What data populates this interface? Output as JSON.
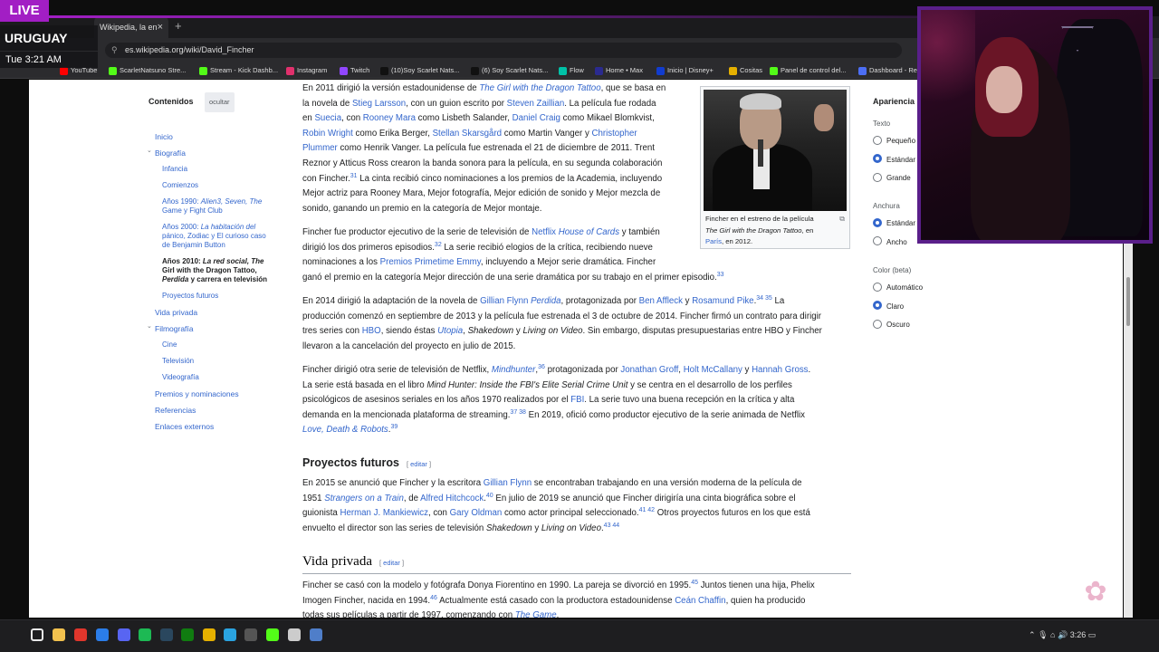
{
  "overlay": {
    "live": "LIVE",
    "country": "URUGUAY",
    "time": "Tue 3:21 AM"
  },
  "browser": {
    "tab_title": "Wikipedia, la en",
    "tab_close": "×",
    "new_tab": "+",
    "url": "es.wikipedia.org/wiki/David_Fincher",
    "bookmarks": [
      {
        "label": "YouTube",
        "color": "#ff0000"
      },
      {
        "label": "ScarletNatsuno Stre...",
        "color": "#53fc18"
      },
      {
        "label": "Stream - Kick Dashb...",
        "color": "#53fc18"
      },
      {
        "label": "Instagram",
        "color": "#e1306c"
      },
      {
        "label": "Twitch",
        "color": "#9146ff"
      },
      {
        "label": "(10)Soy Scarlet Nats...",
        "color": "#111111"
      },
      {
        "label": "(6) Soy Scarlet Nats...",
        "color": "#111111"
      },
      {
        "label": "Flow",
        "color": "#00c2a8"
      },
      {
        "label": "Home • Max",
        "color": "#2a2a8f"
      },
      {
        "label": "Inicio | Disney+",
        "color": "#113ccf"
      },
      {
        "label": "Cositas",
        "color": "#e5b000"
      },
      {
        "label": "Panel de control del...",
        "color": "#53fc18"
      },
      {
        "label": "Dashboard - Re",
        "color": "#4c6ef5"
      }
    ]
  },
  "toc": {
    "title": "Contenidos",
    "hide": "ocultar",
    "items": [
      {
        "label": "Inicio"
      },
      {
        "label": "Biografía"
      },
      {
        "label": "Infancia"
      },
      {
        "label": "Comienzos"
      },
      {
        "l1": "Años 1990: ",
        "l1i": "Alien3, Seven, The",
        "l2": "Game y Fight Club"
      },
      {
        "l1": "Años 2000: ",
        "l1i": "La habitación del",
        "l2": "pánico, Zodiac y El curioso caso",
        "l3": "de Benjamin Button"
      },
      {
        "l1": "Años 2010: ",
        "l1i": "La red social, The",
        "l2": "Girl with the Dragon Tattoo,",
        "l3i": "Perdida",
        "l3": " y carrera en televisión"
      },
      {
        "label": "Proyectos futuros"
      },
      {
        "label": "Vida privada"
      },
      {
        "label": "Filmografía"
      },
      {
        "label": "Cine"
      },
      {
        "label": "Televisión"
      },
      {
        "label": "Videografía"
      },
      {
        "label": "Premios y nominaciones"
      },
      {
        "label": "Referencias"
      },
      {
        "label": "Enlaces externos"
      }
    ]
  },
  "figure": {
    "caption_1": "Fincher en el estreno de la película",
    "caption_2i": "The Girl with the Dragon Tattoo",
    "caption_2": ", en",
    "caption_3a": "París",
    "caption_3b": ", en 2012."
  },
  "article": {
    "p1": [
      [
        {
          "t": "En 2011 dirigió la versión estadounidense de "
        },
        {
          "t": "The Girl with the Dragon Tattoo",
          "c": "li"
        },
        {
          "t": ", que se basa en"
        }
      ],
      [
        {
          "t": "la novela de "
        },
        {
          "t": "Stieg Larsson",
          "c": "l"
        },
        {
          "t": ", con un guion escrito por "
        },
        {
          "t": "Steven Zaillian",
          "c": "l"
        },
        {
          "t": ". La película fue rodada"
        }
      ],
      [
        {
          "t": "en "
        },
        {
          "t": "Suecia",
          "c": "l"
        },
        {
          "t": ", con "
        },
        {
          "t": "Rooney Mara",
          "c": "l"
        },
        {
          "t": " como Lisbeth Salander, "
        },
        {
          "t": "Daniel Craig",
          "c": "l"
        },
        {
          "t": " como Mikael Blomkvist,"
        }
      ],
      [
        {
          "t": "Robin Wright",
          "c": "l"
        },
        {
          "t": " como Erika Berger, "
        },
        {
          "t": "Stellan Skarsgård",
          "c": "l"
        },
        {
          "t": " como Martin Vanger y "
        },
        {
          "t": "Christopher",
          "c": "l"
        }
      ],
      [
        {
          "t": "Plummer",
          "c": "l"
        },
        {
          "t": " como Henrik Vanger. La película fue estrenada el 21 de diciembre de 2011. Trent"
        }
      ],
      [
        {
          "t": "Reznor y Atticus Ross crearon la banda sonora para la película, en su segunda colaboración"
        }
      ],
      [
        {
          "t": "con Fincher."
        },
        {
          "t": "31",
          "c": "s"
        },
        {
          "t": " La cinta recibió cinco nominaciones a los premios de la Academia, incluyendo"
        }
      ],
      [
        {
          "t": "Mejor actriz para Rooney Mara, Mejor fotografía, Mejor edición de sonido y Mejor mezcla de"
        }
      ],
      [
        {
          "t": "sonido, ganando un premio en la categoría de Mejor montaje."
        }
      ]
    ],
    "p2": [
      [
        {
          "t": "Fincher fue productor ejecutivo de la serie de televisión de "
        },
        {
          "t": "Netflix",
          "c": "l"
        },
        {
          "t": " "
        },
        {
          "t": "House of Cards",
          "c": "li"
        },
        {
          "t": " y también"
        }
      ],
      [
        {
          "t": "dirigió los dos primeros episodios."
        },
        {
          "t": "32",
          "c": "s"
        },
        {
          "t": " La serie recibió elogios de la crítica, recibiendo nueve"
        }
      ],
      [
        {
          "t": "nominaciones a los "
        },
        {
          "t": "Premios Primetime Emmy",
          "c": "l"
        },
        {
          "t": ", incluyendo a Mejor serie dramática. Fincher"
        }
      ],
      [
        {
          "t": "ganó el premio en la categoría Mejor dirección de una serie dramática por su trabajo en el primer episodio."
        },
        {
          "t": "33",
          "c": "s"
        }
      ]
    ],
    "p3": [
      [
        {
          "t": "En 2014 dirigió la adaptación de la novela de "
        },
        {
          "t": "Gillian Flynn",
          "c": "l"
        },
        {
          "t": " "
        },
        {
          "t": "Perdida",
          "c": "li"
        },
        {
          "t": ", protagonizada por "
        },
        {
          "t": "Ben Affleck",
          "c": "l"
        },
        {
          "t": " y "
        },
        {
          "t": "Rosamund Pike",
          "c": "l"
        },
        {
          "t": ".",
          "c": ""
        },
        {
          "t": "34 35",
          "c": "s"
        },
        {
          "t": " La"
        }
      ],
      [
        {
          "t": "producción comenzó en septiembre de 2013 y la película fue estrenada el 3 de octubre de 2014. Fincher firmó un contrato para dirigir"
        }
      ],
      [
        {
          "t": "tres series con "
        },
        {
          "t": "HBO",
          "c": "l"
        },
        {
          "t": ", siendo éstas "
        },
        {
          "t": "Utopia",
          "c": "li"
        },
        {
          "t": ", "
        },
        {
          "t": "Shakedown",
          "c": "i"
        },
        {
          "t": " y "
        },
        {
          "t": "Living on Video",
          "c": "i"
        },
        {
          "t": ". Sin embargo, disputas presupuestarias entre HBO y Fincher"
        }
      ],
      [
        {
          "t": "llevaron a la cancelación del proyecto en julio de 2015."
        }
      ]
    ],
    "p4": [
      [
        {
          "t": "Fincher dirigió otra serie de televisión de Netflix, "
        },
        {
          "t": "Mindhunter",
          "c": "li"
        },
        {
          "t": ",",
          "c": ""
        },
        {
          "t": "36",
          "c": "s"
        },
        {
          "t": " protagonizada por "
        },
        {
          "t": "Jonathan Groff",
          "c": "l"
        },
        {
          "t": ", "
        },
        {
          "t": "Holt McCallany",
          "c": "l"
        },
        {
          "t": " y "
        },
        {
          "t": "Hannah Gross",
          "c": "l"
        },
        {
          "t": "."
        }
      ],
      [
        {
          "t": "La serie está basada en el libro "
        },
        {
          "t": "Mind Hunter: Inside the FBI's Elite Serial Crime Unit",
          "c": "i"
        },
        {
          "t": " y se centra en el desarrollo de los perfiles"
        }
      ],
      [
        {
          "t": "psicológicos de asesinos seriales en los años 1970 realizados por el "
        },
        {
          "t": "FBI",
          "c": "l"
        },
        {
          "t": ". La serie tuvo una buena recepción en la crítica y alta"
        }
      ],
      [
        {
          "t": "demanda en la mencionada plataforma de streaming."
        },
        {
          "t": "37 38",
          "c": "s"
        },
        {
          "t": " En 2019, ofició como productor ejecutivo de la serie animada de Netflix"
        }
      ],
      [
        {
          "t": "Love, Death & Robots",
          "c": "li"
        },
        {
          "t": ".",
          "c": ""
        },
        {
          "t": "39",
          "c": "s"
        }
      ]
    ],
    "h_future": "Proyectos futuros",
    "edit": "editar",
    "p5": [
      [
        {
          "t": "En 2015 se anunció que Fincher y la escritora "
        },
        {
          "t": "Gillian Flynn",
          "c": "l"
        },
        {
          "t": " se encontraban trabajando en una versión moderna de la película de"
        }
      ],
      [
        {
          "t": "1951 "
        },
        {
          "t": "Strangers on a Train",
          "c": "li"
        },
        {
          "t": ", de "
        },
        {
          "t": "Alfred Hitchcock",
          "c": "l"
        },
        {
          "t": ".",
          "c": ""
        },
        {
          "t": "40",
          "c": "s"
        },
        {
          "t": " En julio de 2019 se anunció que Fincher dirigiría una cinta biográfica sobre el"
        }
      ],
      [
        {
          "t": "guionista "
        },
        {
          "t": "Herman J. Mankiewicz",
          "c": "l"
        },
        {
          "t": ", con "
        },
        {
          "t": "Gary Oldman",
          "c": "l"
        },
        {
          "t": " como actor principal seleccionado."
        },
        {
          "t": "41 42",
          "c": "s"
        },
        {
          "t": " Otros proyectos futuros en los que está"
        }
      ],
      [
        {
          "t": "envuelto el director son las series de televisión "
        },
        {
          "t": "Shakedown",
          "c": "i"
        },
        {
          "t": " y "
        },
        {
          "t": "Living on Video",
          "c": "i"
        },
        {
          "t": "."
        },
        {
          "t": "43 44",
          "c": "s"
        }
      ]
    ],
    "h_private": "Vida privada",
    "p6": [
      [
        {
          "t": "Fincher se casó con la modelo y fotógrafa Donya Fiorentino en 1990. La pareja se divorció en 1995."
        },
        {
          "t": "45",
          "c": "s"
        },
        {
          "t": " Juntos tienen una hija, Phelix"
        }
      ],
      [
        {
          "t": "Imogen Fincher, nacida en 1994."
        },
        {
          "t": "46",
          "c": "s"
        },
        {
          "t": " Actualmente está casado con la productora estadounidense "
        },
        {
          "t": "Ceán Chaffin",
          "c": "l"
        },
        {
          "t": ", quien ha producido"
        }
      ],
      [
        {
          "t": "todas sus películas a partir de 1997, comenzando con "
        },
        {
          "t": "The Game",
          "c": "li"
        },
        {
          "t": "."
        }
      ]
    ]
  },
  "appearance": {
    "title": "Apariencia",
    "text_label": "Texto",
    "text_options": [
      "Pequeño",
      "Estándar",
      "Grande"
    ],
    "width_label": "Anchura",
    "width_options": [
      "Estándar",
      "Ancho"
    ],
    "color_label": "Color (beta)",
    "color_options": [
      "Automático",
      "Claro",
      "Oscuro"
    ]
  },
  "taskbar": {
    "time": "3:26"
  }
}
